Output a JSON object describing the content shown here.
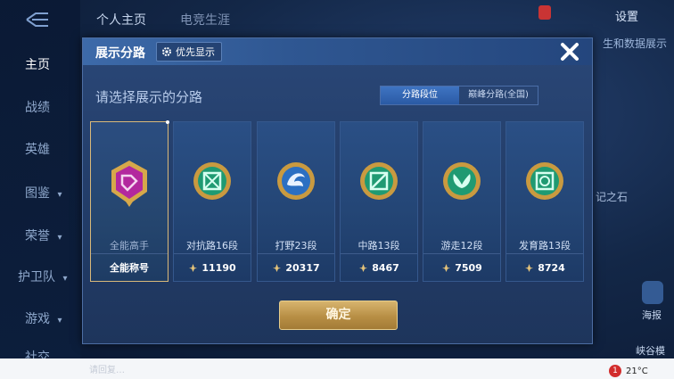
{
  "top": {
    "tabs": [
      "个人主页",
      "电竞生涯"
    ],
    "settings_label": "设置",
    "right_bg_text": "生和数据展示"
  },
  "leftnav": {
    "items": [
      {
        "label": "主页",
        "active": true
      },
      {
        "label": "战绩",
        "active": false
      },
      {
        "label": "英雄",
        "active": false
      },
      {
        "label": "图鉴",
        "active": false,
        "chevron": "▾"
      },
      {
        "label": "荣誉",
        "active": false,
        "chevron": "▾"
      },
      {
        "label": "护卫队",
        "active": false,
        "chevron": "▾"
      },
      {
        "label": "游戏",
        "active": false,
        "chevron": "▾"
      },
      {
        "label": "社交",
        "active": false
      }
    ]
  },
  "right_side": {
    "mid_label": "记之石",
    "label_a": "海报",
    "label_b": "峡谷模"
  },
  "modal": {
    "title": "展示分路",
    "priority_label": "优先显示",
    "subtitle": "请选择展示的分路",
    "segment": {
      "options": [
        "分路段位",
        "巅峰分路(全国)"
      ],
      "active": 0
    },
    "cards": [
      {
        "label": "全能高手",
        "footer_text": "全能称号",
        "score": "",
        "selected": true,
        "color": "#b3289e"
      },
      {
        "label": "对抗路16段",
        "score": "11190",
        "selected": false,
        "color": "#1f9a72"
      },
      {
        "label": "打野23段",
        "score": "20317",
        "selected": false,
        "color": "#2b6fc2"
      },
      {
        "label": "中路13段",
        "score": "8467",
        "selected": false,
        "color": "#1f9a72"
      },
      {
        "label": "游走12段",
        "score": "7509",
        "selected": false,
        "color": "#1f9a72"
      },
      {
        "label": "发育路13段",
        "score": "8724",
        "selected": false,
        "color": "#1f9a72"
      }
    ],
    "confirm_label": "确定"
  },
  "taskbar": {
    "notification_count": "1",
    "temperature": "21°C",
    "faint_text": "请回复…"
  },
  "colors": {
    "accent_gold": "#d7b46e",
    "panel_blue": "#223c67",
    "active_tab": "#2f63b3"
  }
}
